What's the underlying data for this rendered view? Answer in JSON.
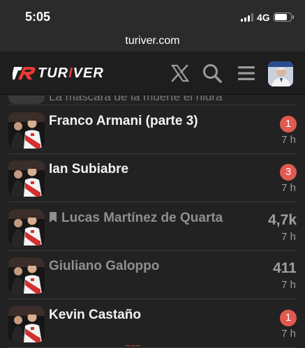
{
  "status_bar": {
    "time": "5:05",
    "network": "4G"
  },
  "browser": {
    "url": "turiver.com"
  },
  "header": {
    "logo_text_a": "TUR",
    "logo_text_b": "I",
    "logo_text_c": "VER"
  },
  "partial_topic": {
    "title": "La máscara de la muerte el hidra"
  },
  "topics": [
    {
      "title": "Franco Armani (parte 3)",
      "badge": "1",
      "count": "",
      "age": "7 h",
      "read": false,
      "bookmarked": false
    },
    {
      "title": "Ian Subiabre",
      "badge": "3",
      "count": "",
      "age": "7 h",
      "read": false,
      "bookmarked": false
    },
    {
      "title": "Lucas Martínez de Quarta",
      "badge": "",
      "count": "4,7k",
      "age": "7 h",
      "read": true,
      "bookmarked": true
    },
    {
      "title": "Giuliano Galoppo",
      "badge": "",
      "count": "411",
      "age": "7 h",
      "read": true,
      "bookmarked": false
    },
    {
      "title": "Kevin Castaño",
      "badge": "1",
      "count": "",
      "age": "7 h",
      "read": false,
      "bookmarked": false
    }
  ],
  "colors": {
    "accent": "#e53935",
    "badge": "#e05a4f",
    "background": "#222222"
  }
}
